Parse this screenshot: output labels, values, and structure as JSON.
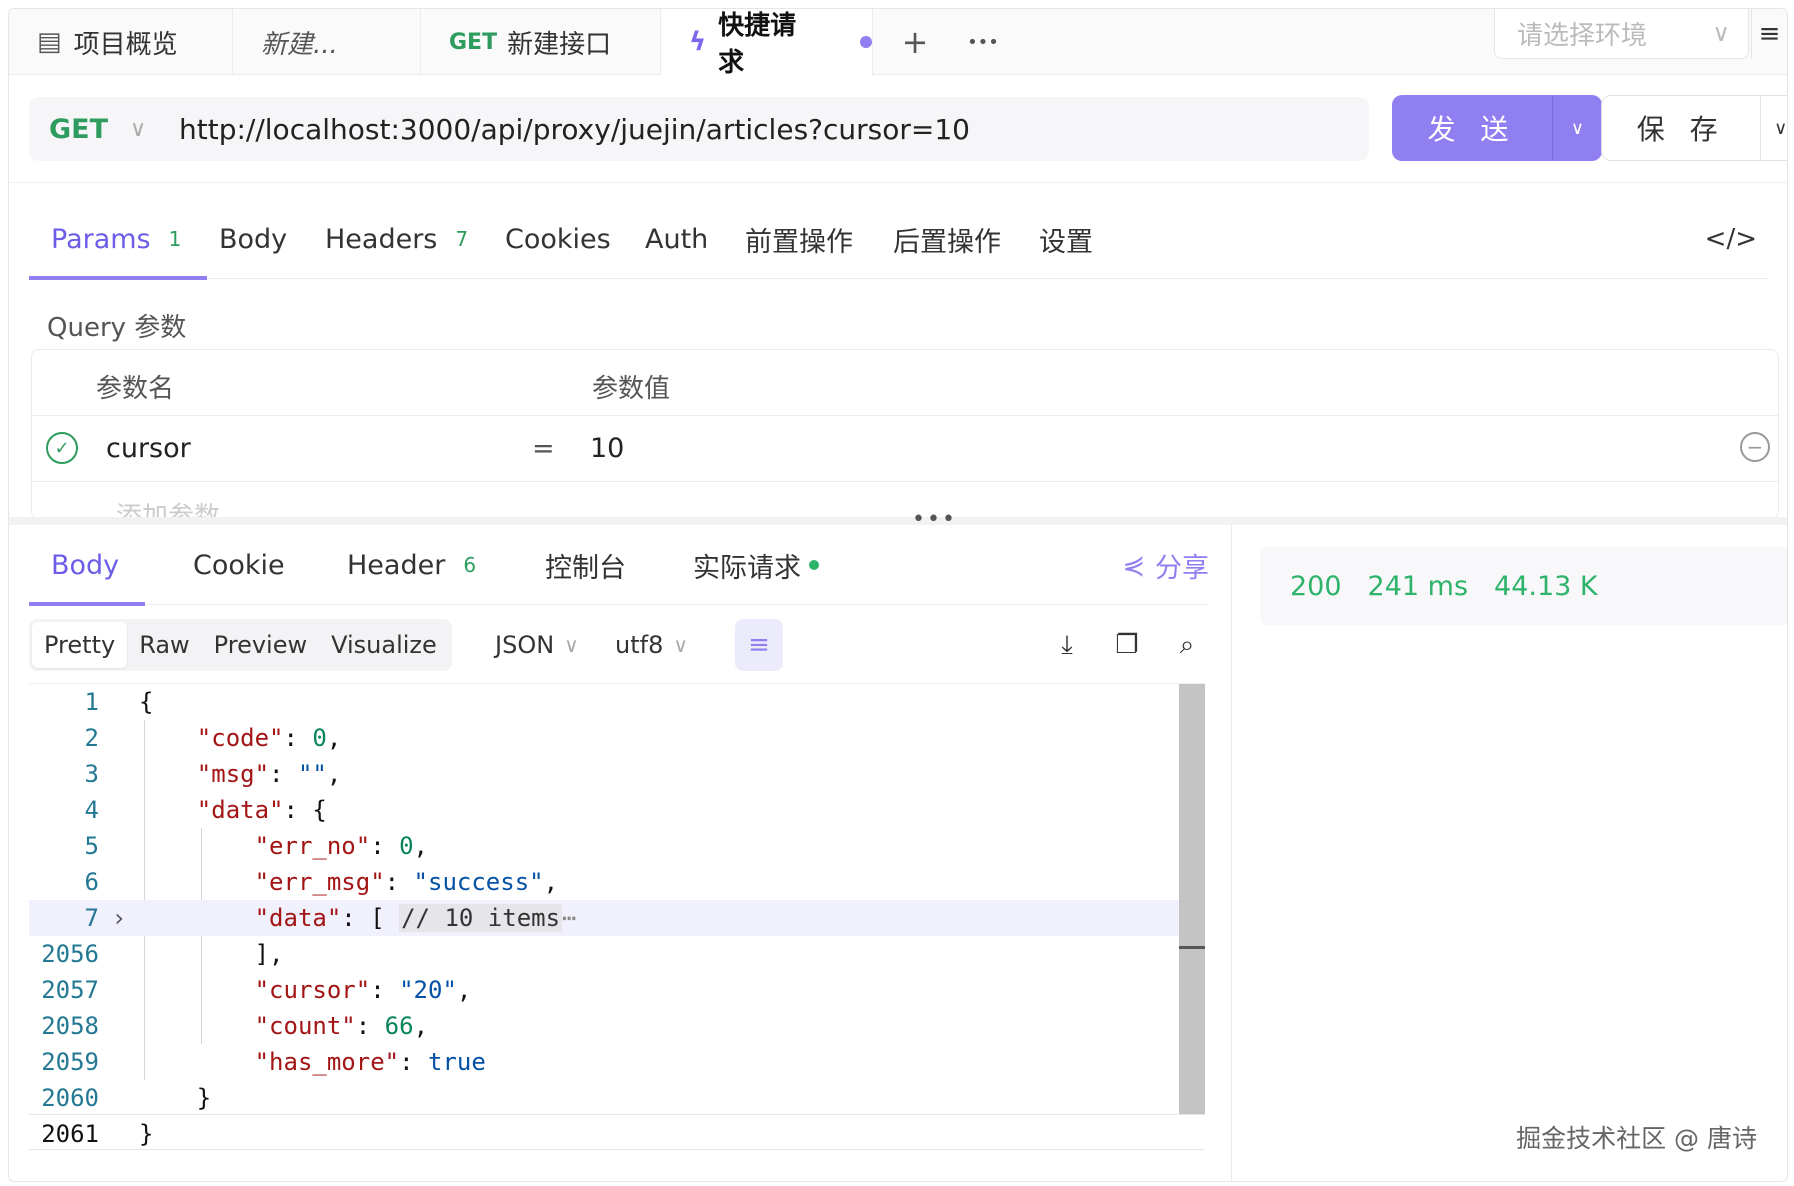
{
  "tabs": [
    {
      "label": "项目概览",
      "icon": "layout-icon"
    },
    {
      "label": "新建..."
    },
    {
      "method": "GET",
      "label": "新建接口"
    },
    {
      "label": "快捷请求",
      "icon": "bolt-icon",
      "active": true
    }
  ],
  "tab_add": "+",
  "tab_more": "•••",
  "env": {
    "placeholder": "请选择环境"
  },
  "menu_glyph": "≡",
  "request": {
    "method": "GET",
    "url": "http://localhost:3000/api/proxy/juejin/articles?cursor=10",
    "send_label": "发 送",
    "save_label": "保 存"
  },
  "request_tabs": [
    {
      "label": "Params",
      "badge": "1",
      "active": true
    },
    {
      "label": "Body"
    },
    {
      "label": "Headers",
      "badge": "7"
    },
    {
      "label": "Cookies"
    },
    {
      "label": "Auth"
    },
    {
      "label": "前置操作"
    },
    {
      "label": "后置操作"
    },
    {
      "label": "设置"
    }
  ],
  "code_toggle": "</>",
  "query": {
    "label": "Query 参数",
    "col_name": "参数名",
    "col_value": "参数值",
    "rows": [
      {
        "name": "cursor",
        "eq": "=",
        "value": "10"
      }
    ],
    "add_placeholder": "添加参数"
  },
  "resizer": "•••",
  "response_tabs": [
    {
      "label": "Body",
      "active": true
    },
    {
      "label": "Cookie"
    },
    {
      "label": "Header",
      "badge": "6"
    },
    {
      "label": "控制台"
    },
    {
      "label": "实际请求"
    }
  ],
  "share_label": "分享",
  "format": {
    "modes": [
      "Pretty",
      "Raw",
      "Preview",
      "Visualize"
    ],
    "active_mode": "Pretty",
    "type": "JSON",
    "encoding": "utf8"
  },
  "code_lines": [
    {
      "n": "1"
    },
    {
      "n": "2"
    },
    {
      "n": "3"
    },
    {
      "n": "4"
    },
    {
      "n": "5"
    },
    {
      "n": "6"
    },
    {
      "n": "7"
    },
    {
      "n": "2056"
    },
    {
      "n": "2057"
    },
    {
      "n": "2058"
    },
    {
      "n": "2059"
    },
    {
      "n": "2060"
    },
    {
      "n": "2061"
    }
  ],
  "json": {
    "code_key": "\"code\"",
    "code_val": "0",
    "msg_key": "\"msg\"",
    "msg_val": "\"\"",
    "data_key": "\"data\"",
    "err_no_key": "\"err_no\"",
    "err_no_val": "0",
    "err_msg_key": "\"err_msg\"",
    "err_msg_val": "\"success\"",
    "inner_data_key": "\"data\"",
    "inner_data_comment": "// 10 items",
    "cursor_key": "\"cursor\"",
    "cursor_val": "\"20\"",
    "count_key": "\"count\"",
    "count_val": "66",
    "has_more_key": "\"has_more\"",
    "has_more_val": "true"
  },
  "status": {
    "code": "200",
    "time": "241 ms",
    "size": "44.13 K"
  },
  "watermark": "掘金技术社区 @ 唐诗",
  "colors": {
    "accent": "#8f7ff0",
    "success": "#2eb36a",
    "method_get": "#2e9c5e"
  }
}
